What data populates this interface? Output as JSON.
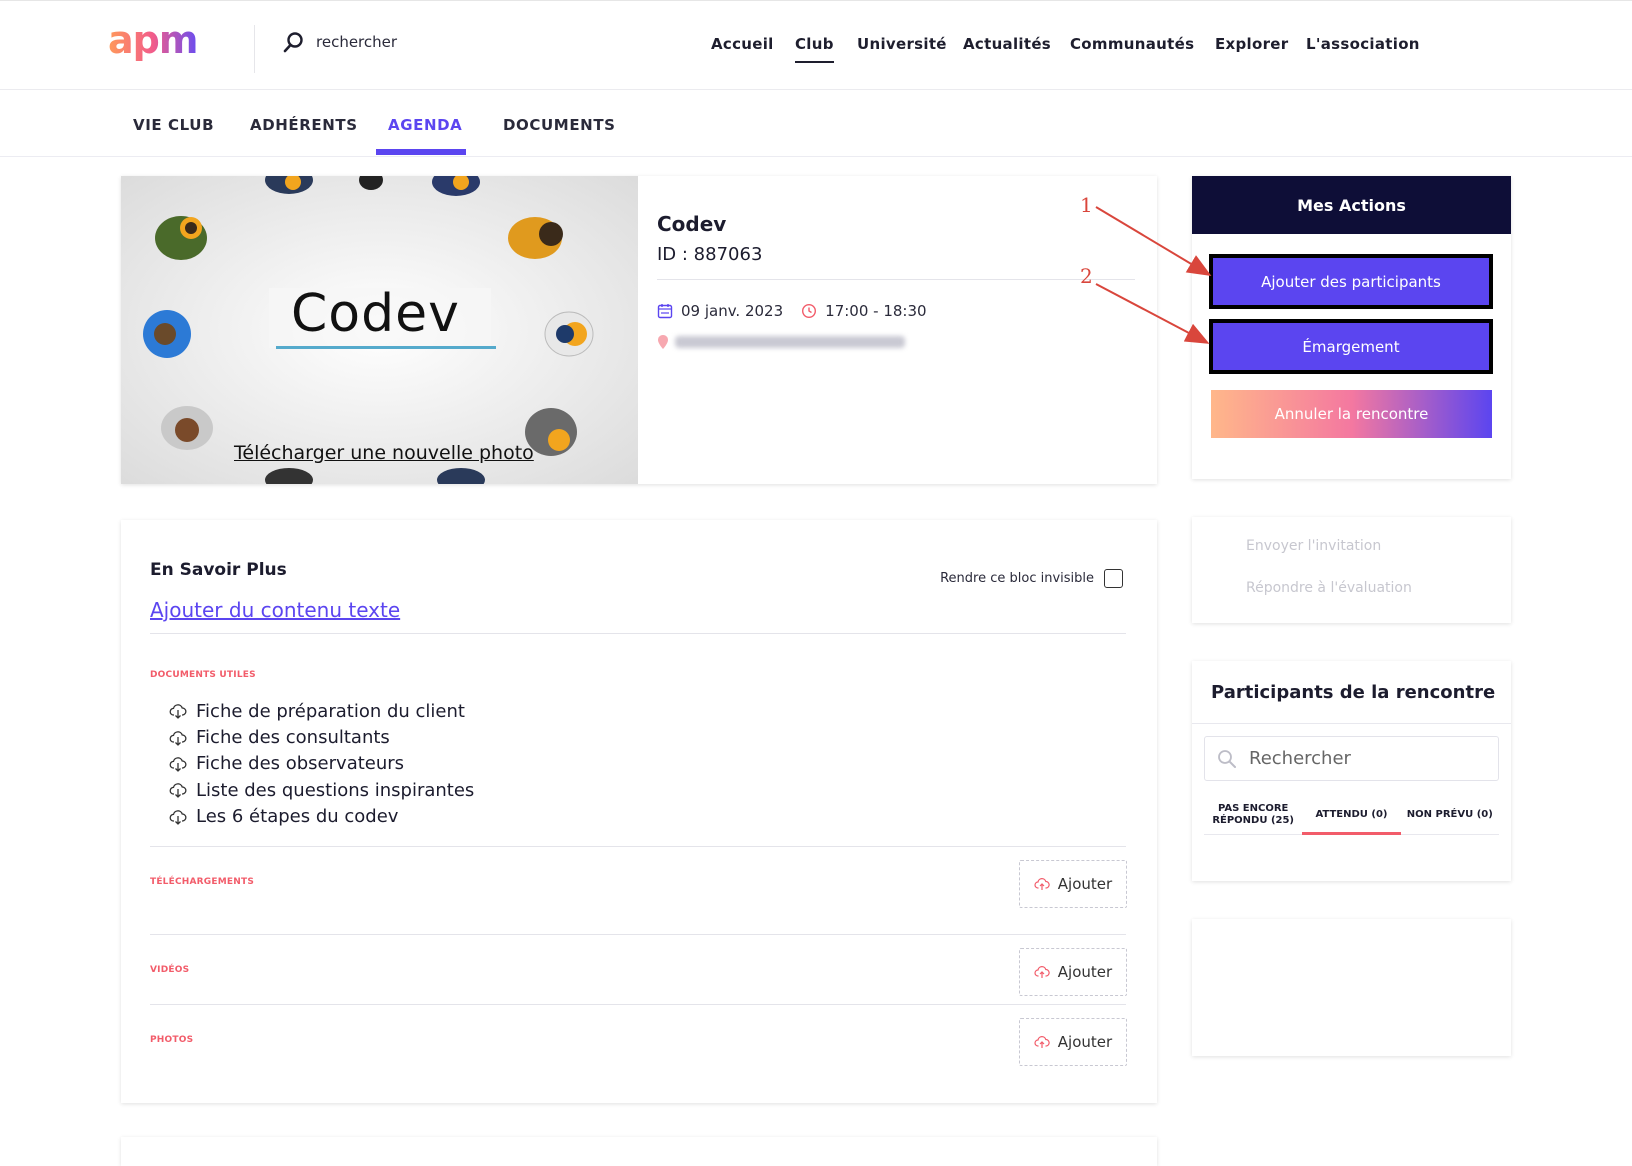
{
  "header": {
    "logo_text": "apm",
    "search_text": "rechercher",
    "nav": [
      {
        "label": "Accueil",
        "active": false
      },
      {
        "label": "Club",
        "active": true
      },
      {
        "label": "Université",
        "active": false
      },
      {
        "label": "Actualités",
        "active": false
      },
      {
        "label": "Communautés",
        "active": false
      },
      {
        "label": "Explorer",
        "active": false
      },
      {
        "label": "L'association",
        "active": false
      }
    ]
  },
  "subnav": {
    "items": [
      {
        "label": "VIE CLUB",
        "active": false
      },
      {
        "label": "ADHÉRENTS",
        "active": false
      },
      {
        "label": "AGENDA",
        "active": true
      },
      {
        "label": "DOCUMENTS",
        "active": false
      }
    ]
  },
  "event": {
    "image_text": "Codev",
    "upload_link": "Télécharger une nouvelle photo",
    "title": "Codev",
    "id_label": "ID : 887063",
    "date": "09 janv. 2023",
    "time": "17:00 - 18:30"
  },
  "details": {
    "title": "En Savoir Plus",
    "add_text_link": "Ajouter du contenu texte",
    "invisible_label": "Rendre ce bloc invisible",
    "documents_label": "DOCUMENTS UTILES",
    "documents": [
      "Fiche de préparation du client",
      "Fiche des consultants",
      "Fiche des observateurs",
      "Liste des questions inspirantes",
      "Les 6 étapes du codev"
    ],
    "downloads_label": "TÉLÉCHARGEMENTS",
    "videos_label": "VIDÉOS",
    "photos_label": "PHOTOS",
    "add_label": "Ajouter"
  },
  "actions": {
    "title": "Mes Actions",
    "add_participants": "Ajouter des participants",
    "attendance": "Émargement",
    "cancel": "Annuler la rencontre",
    "send_invitation": "Envoyer l'invitation",
    "answer_evaluation": "Répondre à l'évaluation"
  },
  "participants": {
    "title": "Participants de la rencontre",
    "search_placeholder": "Rechercher",
    "tabs": [
      {
        "label": "PAS ENCORE RÉPONDU (25)",
        "active": false
      },
      {
        "label": "ATTENDU (0)",
        "active": true
      },
      {
        "label": "NON PRÉVU (0)",
        "active": false
      }
    ]
  },
  "annotations": [
    "1",
    "2"
  ],
  "colors": {
    "accent": "#5b45f0",
    "dark_header": "#0e0e37",
    "section_label": "#f25c6a",
    "annotation": "#d9463c"
  }
}
